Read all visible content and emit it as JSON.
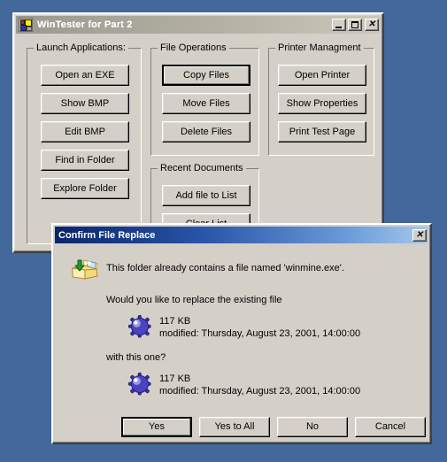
{
  "desktop": {
    "background_color": "#42689c"
  },
  "main_window": {
    "title": "WinTester for Part 2",
    "icon": "app-icon",
    "titlebar_buttons": [
      {
        "name": "minimize",
        "glyph": "_"
      },
      {
        "name": "maximize",
        "glyph": "□"
      },
      {
        "name": "close",
        "glyph": "✕"
      }
    ],
    "groups": [
      {
        "id": "launch-applications",
        "title": "Launch Applications:",
        "buttons": [
          "Open an EXE",
          "Show BMP",
          "Edit BMP",
          "Find in Folder",
          "Explore Folder"
        ]
      },
      {
        "id": "file-operations",
        "title": "File Operations",
        "buttons": [
          "Copy Files",
          "Move Files",
          "Delete Files"
        ]
      },
      {
        "id": "recent-documents",
        "title": "Recent Documents",
        "buttons": [
          "Add file to List",
          "Clear List"
        ]
      },
      {
        "id": "printer-management",
        "title": "Printer Managment",
        "buttons": [
          "Open Printer",
          "Show Properties",
          "Print Test Page"
        ]
      }
    ]
  },
  "dialog": {
    "title": "Confirm File Replace",
    "close_glyph": "✕",
    "icon": "copy-replace-icon",
    "message": "This folder already contains a file named 'winmine.exe'.",
    "question_before": "Would you like to replace the existing file",
    "question_after": "with this one?",
    "existing_file": {
      "icon": "mine-icon",
      "size": "117 KB",
      "modified": "modified: Thursday, August 23, 2001, 14:00:00"
    },
    "new_file": {
      "icon": "mine-icon",
      "size": "117 KB",
      "modified": "modified: Thursday, August 23, 2001, 14:00:00"
    },
    "buttons": [
      {
        "label": "Yes",
        "default": true
      },
      {
        "label": "Yes to All",
        "default": false
      },
      {
        "label": "No",
        "default": false
      },
      {
        "label": "Cancel",
        "default": false
      }
    ]
  },
  "colors": {
    "desktop": "#42689c",
    "window_face": "#d4d0c8",
    "active_title_start": "#0a246a",
    "active_title_end": "#a6c8ec",
    "inactive_title_start": "#9a9a8e",
    "inactive_title_end": "#cbc7bb"
  }
}
